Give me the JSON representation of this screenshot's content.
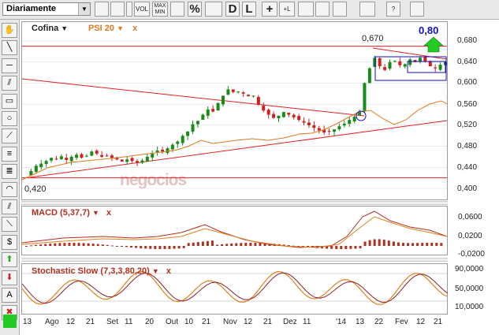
{
  "toolbar": {
    "period": "Diariamente",
    "buttons": [
      {
        "name": "bar-chart-type-button",
        "label": ""
      },
      {
        "name": "candle-chart-type-button",
        "label": ""
      },
      {
        "name": "line-chart-type-button",
        "label": ""
      },
      {
        "name": "volume-button",
        "label": "VOL"
      },
      {
        "name": "max-min-button",
        "label": "MAX\nMIN"
      },
      {
        "name": "grid-button",
        "label": ""
      },
      {
        "name": "percent-button",
        "label": "%"
      },
      {
        "name": "scale-button",
        "label": ""
      },
      {
        "name": "daily-button",
        "label": "D"
      },
      {
        "name": "log-button",
        "label": "L"
      },
      {
        "name": "crosshair-button",
        "label": "+"
      },
      {
        "name": "crosshair-l-button",
        "label": "+L"
      },
      {
        "name": "zigzag-button",
        "label": ""
      },
      {
        "name": "zoom-in-button",
        "label": ""
      },
      {
        "name": "zoom-out-button",
        "label": ""
      },
      {
        "name": "print-button",
        "label": ""
      },
      {
        "name": "help-button",
        "label": "?"
      },
      {
        "name": "info-button",
        "label": ""
      }
    ]
  },
  "sidebar": {
    "tools": [
      {
        "name": "hand-tool-button",
        "glyph": "✋"
      },
      {
        "name": "line-tool-button",
        "glyph": "╲"
      },
      {
        "name": "horizontal-line-tool-button",
        "glyph": "─"
      },
      {
        "name": "parallel-tool-button",
        "glyph": "⫽"
      },
      {
        "name": "rectangle-tool-button",
        "glyph": "▭"
      },
      {
        "name": "circle-tool-button",
        "glyph": "○"
      },
      {
        "name": "fibonacci-fan-tool-button",
        "glyph": "⟋"
      },
      {
        "name": "fibonacci-retracement-tool-button",
        "glyph": "≡"
      },
      {
        "name": "fibonacci-levels-tool-button",
        "glyph": "≣"
      },
      {
        "name": "arc-tool-button",
        "glyph": "◠"
      },
      {
        "name": "channel-tool-button",
        "glyph": "⫽"
      },
      {
        "name": "gann-tool-button",
        "glyph": "⟍"
      },
      {
        "name": "dollar-tool-button",
        "glyph": "$"
      },
      {
        "name": "up-arrow-tool-button",
        "glyph": "⬆"
      },
      {
        "name": "down-arrow-tool-button",
        "glyph": "⬇"
      },
      {
        "name": "text-tool-button",
        "glyph": "A"
      },
      {
        "name": "delete-tool-button",
        "glyph": "✖"
      }
    ]
  },
  "main": {
    "ticker": "Cofina",
    "indicator": "PSI 20",
    "close_marker": "x",
    "dropdown_marker": "▼",
    "high_label": "0,670",
    "low_label": "0,420",
    "target_label": "0,80",
    "watermark": "negocios",
    "y_ticks": [
      "0,680",
      "0,640",
      "0,600",
      "0,560",
      "0,520",
      "0,480",
      "0,440",
      "0,400"
    ]
  },
  "macd": {
    "label": "MACD (5,37,7)",
    "y_ticks": [
      "0,0600",
      "0,0200",
      "-0,0200"
    ]
  },
  "stoch": {
    "label": "Stochastic Slow (7,3,3,80,20)",
    "y_ticks": [
      "90,0000",
      "50,0000",
      "10,0000"
    ]
  },
  "x_axis": {
    "labels": [
      "13",
      "Ago",
      "12",
      "21",
      "Set",
      "11",
      "20",
      "Out",
      "10",
      "21",
      "Nov",
      "12",
      "21",
      "Dez",
      "11",
      "'14",
      "13",
      "22",
      "Fev",
      "12",
      "21"
    ]
  },
  "colors": {
    "up": "#1a8a1a",
    "down": "#cc2222",
    "trend": "#e02020",
    "psi": "#e07820",
    "macd": "#b03020",
    "signal": "#e08020",
    "stoch_k": "#e08020",
    "stoch_d": "#902020",
    "target": "#1010c0"
  },
  "chart_data": {
    "type": "candlestick",
    "title": "Cofina",
    "ylim": [
      0.395,
      0.695
    ],
    "price_path": [
      0.425,
      0.433,
      0.443,
      0.447,
      0.452,
      0.458,
      0.455,
      0.461,
      0.454,
      0.46,
      0.464,
      0.458,
      0.462,
      0.47,
      0.466,
      0.46,
      0.462,
      0.458,
      0.455,
      0.451,
      0.455,
      0.452,
      0.449,
      0.453,
      0.46,
      0.466,
      0.472,
      0.47,
      0.476,
      0.483,
      0.489,
      0.5,
      0.508,
      0.522,
      0.528,
      0.54,
      0.55,
      0.546,
      0.562,
      0.576,
      0.588,
      0.583,
      0.584,
      0.58,
      0.575,
      0.576,
      0.56,
      0.548,
      0.54,
      0.534,
      0.538,
      0.545,
      0.54,
      0.535,
      0.53,
      0.525,
      0.52,
      0.515,
      0.51,
      0.506,
      0.508,
      0.512,
      0.518,
      0.523,
      0.53,
      0.536,
      0.545,
      0.6,
      0.628,
      0.648,
      0.632,
      0.625,
      0.64,
      0.642,
      0.634,
      0.636,
      0.645,
      0.64,
      0.648,
      0.642,
      0.632,
      0.628,
      0.635,
      0.64
    ]
  }
}
